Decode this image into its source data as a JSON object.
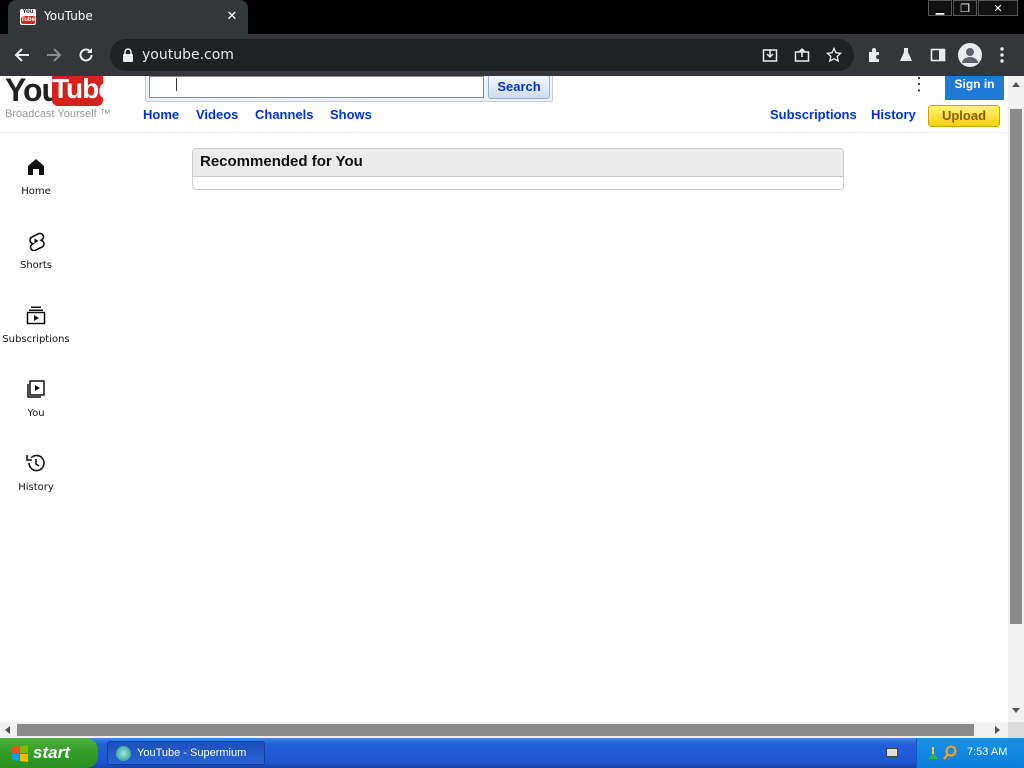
{
  "browser": {
    "tab_title": "YouTube",
    "url": "youtube.com"
  },
  "masthead": {
    "logo_you": "You",
    "logo_tube": "Tube",
    "tagline": "Broadcast Yourself ™",
    "search_button": "Search",
    "search_value": "",
    "nav": [
      "Home",
      "Videos",
      "Channels",
      "Shows"
    ],
    "right_links": [
      "Subscriptions",
      "History"
    ],
    "sign_in": "Sign in",
    "upload": "Upload"
  },
  "guide": {
    "items": [
      {
        "label": "Home",
        "icon": "home-icon"
      },
      {
        "label": "Shorts",
        "icon": "shorts-icon"
      },
      {
        "label": "Subscriptions",
        "icon": "subscriptions-icon"
      },
      {
        "label": "You",
        "icon": "you-library-icon"
      },
      {
        "label": "History",
        "icon": "history-icon"
      }
    ]
  },
  "main": {
    "recommended_title": "Recommended for You"
  },
  "taskbar": {
    "start_label": "start",
    "task_label": "YouTube - Supermium",
    "clock": "7:53 AM"
  },
  "colors": {
    "link_blue": "#0033cc",
    "signin_blue": "#1f7ad6",
    "upload_yellow": "#f5d10e",
    "logo_red": "#d8211c"
  }
}
